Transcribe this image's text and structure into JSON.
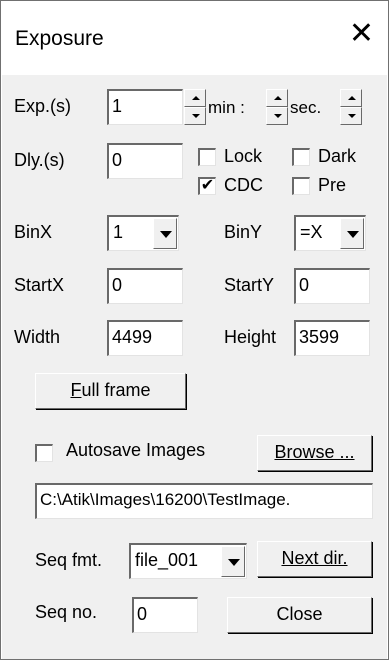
{
  "window": {
    "title": "Exposure",
    "close_glyph": "✕"
  },
  "exposure": {
    "label": "Exp.(s)",
    "value": "1",
    "min_label": "min :",
    "sec_label": "sec."
  },
  "delay": {
    "label": "Dly.(s)",
    "value": "0"
  },
  "checks": {
    "lock": {
      "label": "Lock",
      "checked": false
    },
    "dark": {
      "label": "Dark",
      "checked": false
    },
    "cdc": {
      "label": "CDC",
      "checked": true
    },
    "pre": {
      "label": "Pre",
      "checked": false
    }
  },
  "binx": {
    "label": "BinX",
    "value": "1"
  },
  "biny": {
    "label": "BinY",
    "value": "=X"
  },
  "startx": {
    "label": "StartX",
    "value": "0"
  },
  "starty": {
    "label": "StartY",
    "value": "0"
  },
  "width": {
    "label": "Width",
    "value": "4499"
  },
  "height": {
    "label": "Height",
    "value": "3599"
  },
  "full_frame": {
    "mnemonic": "F",
    "rest": "ull frame"
  },
  "autosave": {
    "label": "Autosave Images",
    "checked": false
  },
  "browse": {
    "label": "Browse ..."
  },
  "path": {
    "value": "C:\\Atik\\Images\\16200\\TestImage."
  },
  "seq_fmt": {
    "label": "Seq fmt.",
    "value": "file_001"
  },
  "next_dir": {
    "label": "Next dir."
  },
  "seq_no": {
    "label": "Seq no.",
    "value": "0"
  },
  "close": {
    "label": "Close"
  },
  "check_glyph": "✔"
}
